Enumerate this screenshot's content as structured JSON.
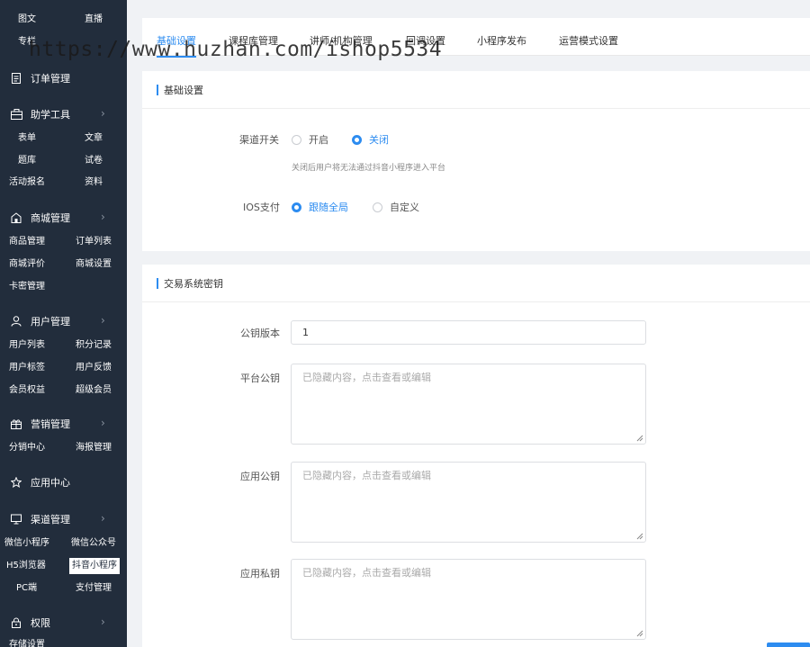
{
  "watermark": "https://www.huzhan.com/ishop5534",
  "sidebar": {
    "top_items": [
      {
        "left": "图文",
        "right": "直播"
      },
      {
        "left": "专栏"
      }
    ],
    "groups": [
      {
        "label": "订单管理",
        "icon": "document-icon",
        "has_chevron": false,
        "items": []
      },
      {
        "label": "助学工具",
        "icon": "toolbox-icon",
        "has_chevron": true,
        "items": [
          [
            "表单",
            "文章"
          ],
          [
            "题库",
            "试卷"
          ],
          [
            "活动报名",
            "资料"
          ]
        ]
      },
      {
        "label": "商城管理",
        "icon": "shop-icon",
        "has_chevron": true,
        "items": [
          [
            "商品管理",
            "订单列表"
          ],
          [
            "商城评价",
            "商城设置"
          ],
          [
            "卡密管理"
          ]
        ]
      },
      {
        "label": "用户管理",
        "icon": "user-icon",
        "has_chevron": true,
        "items": [
          [
            "用户列表",
            "积分记录"
          ],
          [
            "用户标签",
            "用户反馈"
          ],
          [
            "会员权益",
            "超级会员"
          ]
        ]
      },
      {
        "label": "营销管理",
        "icon": "gift-icon",
        "has_chevron": true,
        "items": [
          [
            "分销中心",
            "海报管理"
          ]
        ]
      },
      {
        "label": "应用中心",
        "icon": "star-icon",
        "has_chevron": false,
        "items": []
      },
      {
        "label": "渠道管理",
        "icon": "monitor-icon",
        "has_chevron": true,
        "items": [
          [
            "微信小程序",
            "微信公众号"
          ],
          [
            "H5浏览器",
            "抖音小程序"
          ],
          [
            "PC端",
            "支付管理"
          ]
        ]
      },
      {
        "label": "权限",
        "icon": "lock-icon",
        "has_chevron": true,
        "items": [
          [
            "存储设置"
          ]
        ]
      }
    ],
    "active_item": "抖音小程序"
  },
  "tabs": [
    "基础设置",
    "课程库管理",
    "讲师/机构管理",
    "回调设置",
    "小程序发布",
    "运营模式设置"
  ],
  "active_tab": "基础设置",
  "basic_section": {
    "title": "基础设置",
    "channel_switch_label": "渠道开关",
    "channel_options": [
      "开启",
      "关闭"
    ],
    "channel_selected": "关闭",
    "channel_hint": "关闭后用户将无法通过抖音小程序进入平台",
    "ios_pay_label": "IOS支付",
    "ios_options": [
      "跟随全局",
      "自定义"
    ],
    "ios_selected": "跟随全局"
  },
  "key_section": {
    "title": "交易系统密钥",
    "pubkey_version_label": "公钥版本",
    "pubkey_version_value": "1",
    "platform_pubkey_label": "平台公钥",
    "app_pubkey_label": "应用公钥",
    "app_privkey_label": "应用私钥",
    "hidden_placeholder": "已隐藏内容，点击查看或编辑"
  },
  "colors": {
    "sidebar_bg": "#222d3c",
    "accent": "#2d8cf0",
    "page_bg": "#f0f2f5"
  }
}
